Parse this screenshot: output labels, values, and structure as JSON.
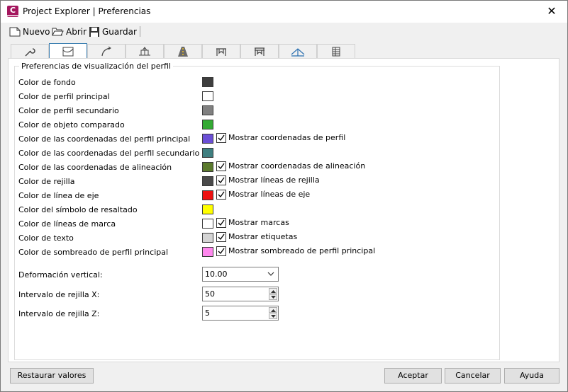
{
  "window": {
    "title": "Project Explorer | Preferencias",
    "app_icon_letter": "C",
    "close_glyph": "✕"
  },
  "toolbar": {
    "new_label": "Nuevo",
    "open_label": "Abrir",
    "save_label": "Guardar"
  },
  "tabs": [
    {
      "icon": "wrench-icon"
    },
    {
      "icon": "profile-view-icon",
      "active": true
    },
    {
      "icon": "alignment-icon"
    },
    {
      "icon": "cross-section-icon"
    },
    {
      "icon": "road-icon"
    },
    {
      "icon": "bridge-icon"
    },
    {
      "icon": "bridge-alt-icon"
    },
    {
      "icon": "surface-icon"
    },
    {
      "icon": "table-icon"
    }
  ],
  "group": {
    "title": "Preferencias de visualización del perfil",
    "rows": [
      {
        "label": "Color de fondo",
        "color": "#3e3e3e"
      },
      {
        "label": "Color de perfil principal",
        "color": "#ffffff"
      },
      {
        "label": "Color de perfil secundario",
        "color": "#808080"
      },
      {
        "label": "Color de objeto comparado",
        "color": "#33aa33"
      },
      {
        "label": "Color de las coordenadas del perfil principal",
        "color": "#6b4fd6",
        "check_label": "Mostrar coordenadas de perfil",
        "checked": true
      },
      {
        "label": "Color de las coordenadas del perfil secundario",
        "color": "#3f7f80"
      },
      {
        "label": "Color de las coordenadas de alineación",
        "color": "#5b7a2d",
        "check_label": "Mostrar coordenadas de alineación",
        "checked": true
      },
      {
        "label": "Color de rejilla",
        "color": "#4a4a4a",
        "check_label": "Mostrar líneas de rejilla",
        "checked": true
      },
      {
        "label": "Color de línea de eje",
        "color": "#ee1111",
        "check_label": "Mostrar líneas de eje",
        "checked": true
      },
      {
        "label": "Color del símbolo de resaltado",
        "color": "#ffff00"
      },
      {
        "label": "Color de líneas de marca",
        "color": "#ffffff",
        "check_label": "Mostrar marcas",
        "checked": true
      },
      {
        "label": "Color de texto",
        "color": "#d4d4d4",
        "check_label": "Mostrar etiquetas",
        "checked": true
      },
      {
        "label": "Color de sombreado de perfil principal",
        "color": "#ff88ee",
        "check_label": "Mostrar sombreado de perfil principal",
        "checked": true
      }
    ],
    "vertical_exaggeration": {
      "label": "Deformación vertical:",
      "value": "10.00"
    },
    "grid_x": {
      "label": "Intervalo de rejilla X:",
      "value": "50"
    },
    "grid_z": {
      "label": "Intervalo de rejilla Z:",
      "value": "5"
    }
  },
  "buttons": {
    "restore": "Restaurar valores",
    "accept": "Aceptar",
    "cancel": "Cancelar",
    "help": "Ayuda"
  }
}
